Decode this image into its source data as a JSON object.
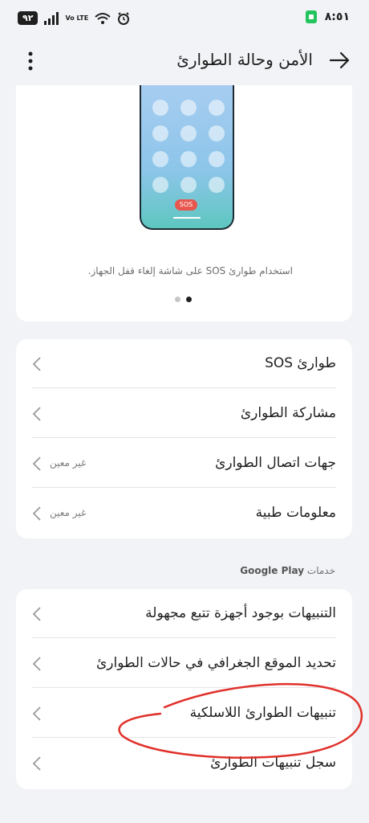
{
  "status_bar": {
    "battery": "٩٢",
    "network": "Vo LTE",
    "time": "٨:٥١"
  },
  "header": {
    "title": "الأمن وحالة الطوارئ",
    "back_icon": "arrow-right-icon",
    "menu_icon": "more-vertical-icon"
  },
  "illustration": {
    "sos_badge": "SOS",
    "caption": "استخدام طوارئ SOS على شاشة إلغاء قفل الجهاز.",
    "pager_total": 2,
    "pager_active": 2
  },
  "emergency_list": [
    {
      "label": "طوارئ SOS",
      "value": ""
    },
    {
      "label": "مشاركة الطوارئ",
      "value": ""
    },
    {
      "label": "جهات اتصال الطوارئ",
      "value": "غير معين"
    },
    {
      "label": "معلومات طبية",
      "value": "غير معين"
    }
  ],
  "google_section": {
    "prefix": "خدمات",
    "brand": "Google Play"
  },
  "google_list": [
    {
      "label": "التنبيهات بوجود أجهزة تتبع مجهولة"
    },
    {
      "label": "تحديد الموقع الجغرافي في حالات الطوارئ"
    },
    {
      "label": "تنبيهات الطوارئ اللاسلكية"
    },
    {
      "label": "سجل تنبيهات الطوارئ"
    }
  ],
  "colors": {
    "background": "#f1f3f6",
    "card": "#ffffff",
    "sos_red": "#e8574f",
    "annotation_red": "#e0312b",
    "charging_green": "#22c45e"
  }
}
